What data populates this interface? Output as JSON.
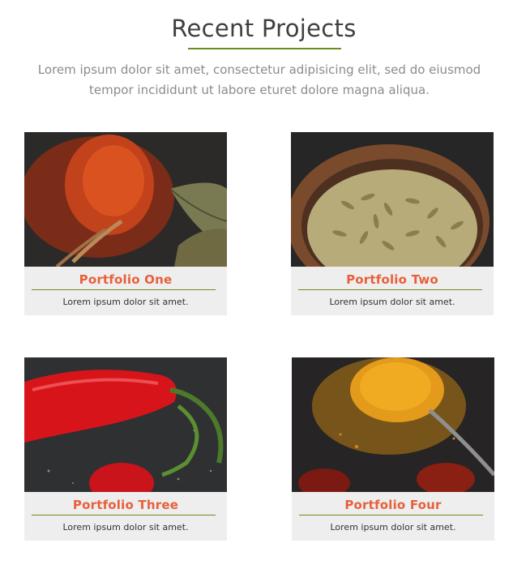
{
  "header": {
    "title": "Recent Projects",
    "intro": "Lorem ipsum dolor sit amet, consectetur adipisicing elit, sed do eiusmod tempor incididunt ut labore eturet dolore magna aliqua."
  },
  "colors": {
    "accent_title": "#e8603a",
    "accent_line": "#6d8c1f",
    "card_bg": "#eeeeee"
  },
  "portfolio": [
    {
      "title": "Portfolio One",
      "text": "Lorem ipsum dolor sit amet.",
      "image": "paprika-spoon-image"
    },
    {
      "title": "Portfolio Two",
      "text": "Lorem ipsum dolor sit amet.",
      "image": "fennel-seeds-bowl-image"
    },
    {
      "title": "Portfolio Three",
      "text": "Lorem ipsum dolor sit amet.",
      "image": "red-chili-pepper-image"
    },
    {
      "title": "Portfolio Four",
      "text": "Lorem ipsum dolor sit amet.",
      "image": "turmeric-spoon-image"
    }
  ]
}
